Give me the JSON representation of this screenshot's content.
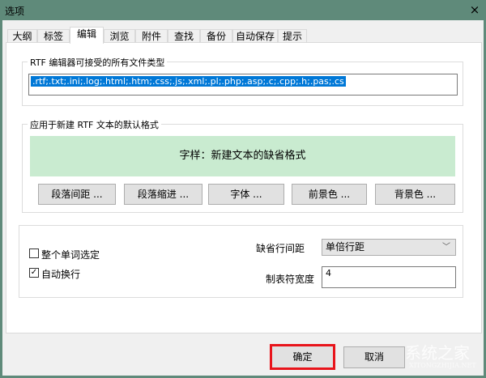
{
  "window": {
    "title": "选项",
    "close_icon": "×"
  },
  "tabs": [
    {
      "label": "大纲"
    },
    {
      "label": "标签"
    },
    {
      "label": "编辑",
      "active": true
    },
    {
      "label": "浏览"
    },
    {
      "label": "附件"
    },
    {
      "label": "查找"
    },
    {
      "label": "备份"
    },
    {
      "label": "自动保存"
    },
    {
      "label": "提示"
    }
  ],
  "file_types": {
    "label": "RTF 编辑器可接受的所有文件类型",
    "value": ".rtf;.txt;.ini;.log;.html;.htm;.css;.js;.xml;.pl;.php;.asp;.c;.cpp;.h;.pas;.cs"
  },
  "default_format": {
    "label": "应用于新建 RTF 文本的默认格式",
    "sample": "字样：新建文本的缺省格式",
    "buttons": [
      "段落间距 ...",
      "段落缩进 ...",
      "字体 ...",
      "前景色 ...",
      "背景色 ..."
    ]
  },
  "options": {
    "whole_word": {
      "label": "整个单词选定",
      "checked": false
    },
    "word_wrap": {
      "label": "自动换行",
      "checked": true
    },
    "line_spacing": {
      "label": "缺省行间距",
      "value": "单倍行距"
    },
    "tab_width": {
      "label": "制表符宽度",
      "value": "4"
    }
  },
  "footer": {
    "ok": "确定",
    "cancel": "取消"
  },
  "watermark": {
    "text": "系统之家",
    "sub": "XITONGZHIJIA.NET"
  }
}
